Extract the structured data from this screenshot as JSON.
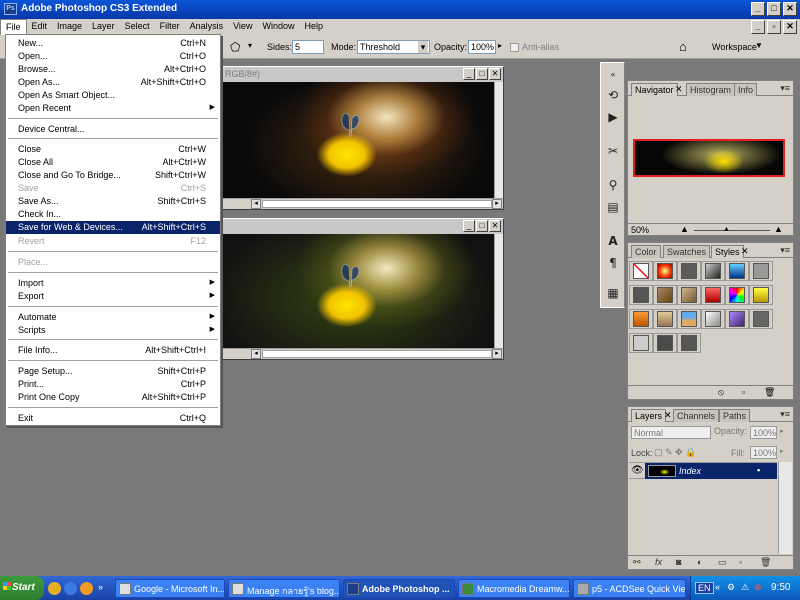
{
  "app": {
    "title": "Adobe Photoshop CS3 Extended",
    "logo": "Ps"
  },
  "menubar": [
    "File",
    "Edit",
    "Image",
    "Layer",
    "Select",
    "Filter",
    "Analysis",
    "View",
    "Window",
    "Help"
  ],
  "options": {
    "sides_label": "Sides:",
    "sides_value": "5",
    "mode_label": "Mode:",
    "mode_value": "Threshold",
    "opacity_label": "Opacity:",
    "opacity_value": "100%",
    "antialias_label": "Anti-alias",
    "workspace_label": "Workspace"
  },
  "file_menu": [
    {
      "label": "New...",
      "shortcut": "Ctrl+N"
    },
    {
      "label": "Open...",
      "shortcut": "Ctrl+O"
    },
    {
      "label": "Browse...",
      "shortcut": "Alt+Ctrl+O"
    },
    {
      "label": "Open As...",
      "shortcut": "Alt+Shift+Ctrl+O"
    },
    {
      "label": "Open As Smart Object...",
      "shortcut": ""
    },
    {
      "label": "Open Recent",
      "shortcut": ""
    },
    {
      "label": "Device Central...",
      "shortcut": ""
    },
    {
      "label": "Close",
      "shortcut": "Ctrl+W"
    },
    {
      "label": "Close All",
      "shortcut": "Alt+Ctrl+W"
    },
    {
      "label": "Close and Go To Bridge...",
      "shortcut": "Shift+Ctrl+W"
    },
    {
      "label": "Save",
      "shortcut": "Ctrl+S"
    },
    {
      "label": "Save As...",
      "shortcut": "Shift+Ctrl+S"
    },
    {
      "label": "Check In...",
      "shortcut": ""
    },
    {
      "label": "Save for Web & Devices...",
      "shortcut": "Alt+Shift+Ctrl+S"
    },
    {
      "label": "Revert",
      "shortcut": "F12"
    },
    {
      "label": "Place...",
      "shortcut": ""
    },
    {
      "label": "Import",
      "shortcut": ""
    },
    {
      "label": "Export",
      "shortcut": ""
    },
    {
      "label": "Automate",
      "shortcut": ""
    },
    {
      "label": "Scripts",
      "shortcut": ""
    },
    {
      "label": "File Info...",
      "shortcut": "Alt+Shift+Ctrl+I"
    },
    {
      "label": "Page Setup...",
      "shortcut": "Shift+Ctrl+P"
    },
    {
      "label": "Print...",
      "shortcut": "Ctrl+P"
    },
    {
      "label": "Print One Copy",
      "shortcut": "Alt+Shift+Ctrl+P"
    },
    {
      "label": "Exit",
      "shortcut": "Ctrl+Q"
    }
  ],
  "doc1": {
    "title_fragment": "RGB/8#)"
  },
  "navigator": {
    "tabs": [
      "Navigator",
      "Histogram",
      "Info"
    ],
    "zoom": "50%"
  },
  "styles": {
    "tabs": [
      "Color",
      "Swatches",
      "Styles"
    ]
  },
  "layers": {
    "tabs": [
      "Layers",
      "Channels",
      "Paths"
    ],
    "blend_mode": "Normal",
    "opacity_label": "Opacity:",
    "opacity_value": "100%",
    "lock_label": "Lock:",
    "fill_label": "Fill:",
    "fill_value": "100%",
    "layer_name": "Index"
  },
  "taskbar": {
    "start_label": "Start",
    "buttons": [
      "Google - Microsoft In...",
      "Manage กลายรู้'s blog...",
      "Adobe Photoshop ...",
      "Macromedia Dreamw...",
      "p5 - ACDSee Quick View"
    ],
    "lang": "EN",
    "clock": "9:50"
  },
  "colors": {
    "titlebar": "#0a55d8",
    "menu_highlight": "#0a246a",
    "taskbar": "#245edb",
    "layer_selected": "#0a246a"
  }
}
